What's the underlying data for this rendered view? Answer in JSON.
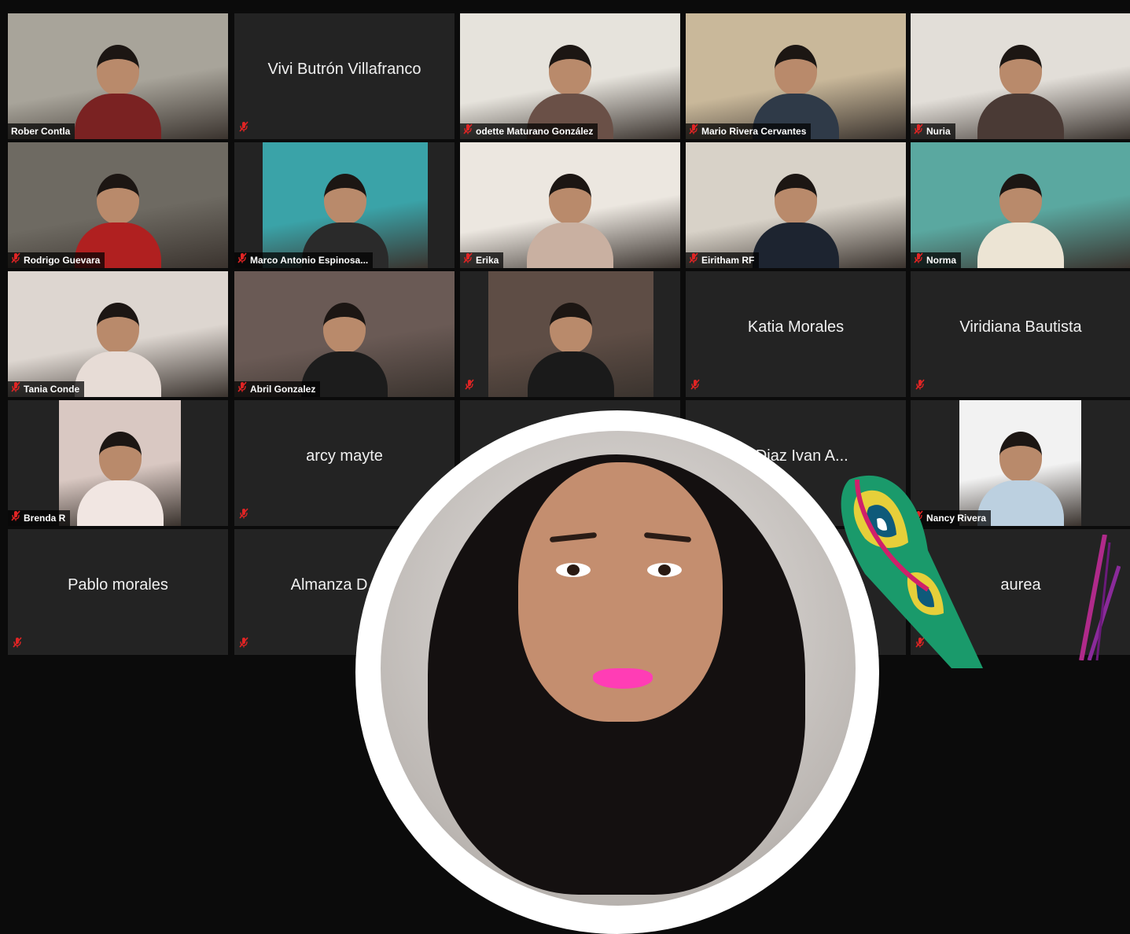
{
  "participants": [
    {
      "name": "Rober Contla",
      "video": true,
      "muted": false,
      "active": true,
      "bg": [
        "#a8a49a",
        "#7a2222"
      ]
    },
    {
      "name": "Vivi Butrón Villafranco",
      "video": false,
      "muted": true
    },
    {
      "name": "odette Maturano González",
      "video": true,
      "muted": true,
      "bg": [
        "#e6e3dc",
        "#6a5047"
      ]
    },
    {
      "name": "Mario Rivera Cervantes",
      "video": true,
      "muted": true,
      "bg": [
        "#c9b89a",
        "#2f3a48"
      ]
    },
    {
      "name": "Nuria",
      "video": true,
      "muted": true,
      "bg": [
        "#e2ded8",
        "#4a3a35"
      ]
    },
    {
      "name": "Rodrigo Guevara",
      "video": true,
      "muted": true,
      "bg": [
        "#6e6a62",
        "#b02020"
      ]
    },
    {
      "name": "Marco Antonio Espinosa...",
      "video": true,
      "muted": true,
      "bg": [
        "#3aa3a8",
        "#2a2a2a"
      ]
    },
    {
      "name": "Erika",
      "video": true,
      "muted": true,
      "bg": [
        "#ece7e0",
        "#c9b0a1"
      ]
    },
    {
      "name": "Eiritham RF",
      "video": true,
      "muted": true,
      "bg": [
        "#d8d2c8",
        "#1d2430"
      ]
    },
    {
      "name": "Norma",
      "video": true,
      "muted": true,
      "bg": [
        "#5aa8a0",
        "#ece4d4"
      ]
    },
    {
      "name": "Tania Conde",
      "video": true,
      "muted": true,
      "bg": [
        "#ddd6d0",
        "#e7dcd6"
      ]
    },
    {
      "name": "Abril Gonzalez",
      "video": true,
      "muted": true,
      "bg": [
        "#6a5a55",
        "#1c1c1c"
      ]
    },
    {
      "name": "",
      "video": true,
      "muted": true,
      "bg": [
        "#5e4d45",
        "#1a1a1a"
      ]
    },
    {
      "name": "Katia Morales",
      "video": false,
      "muted": true
    },
    {
      "name": "Viridiana Bautista",
      "video": false,
      "muted": true
    },
    {
      "name": "Brenda R",
      "video": true,
      "muted": true,
      "bg": [
        "#d9c8c2",
        "#f1e6e2"
      ]
    },
    {
      "name": "arcy mayte",
      "video": false,
      "muted": true
    },
    {
      "name": "",
      "video": false,
      "muted": true
    },
    {
      "name": "z Diaz Ivan A...",
      "video": false,
      "muted": true
    },
    {
      "name": "Nancy Rivera",
      "video": true,
      "muted": true,
      "bg": [
        "#f2f2f2",
        "#bcd0e0"
      ]
    },
    {
      "name": "Pablo morales",
      "video": false,
      "muted": true
    },
    {
      "name": "Almanza D. Ma",
      "video": false,
      "muted": true
    },
    {
      "name": "",
      "video": false,
      "muted": true
    },
    {
      "name": "",
      "video": false,
      "muted": true
    },
    {
      "name": "aurea",
      "video": false,
      "muted": true
    }
  ],
  "colors": {
    "tile": "#232323",
    "active_outline": "#c7e06a",
    "muted_icon": "#e02424",
    "lips": "#ff3db5"
  },
  "icons": {
    "muted": "microphone-muted-icon"
  }
}
